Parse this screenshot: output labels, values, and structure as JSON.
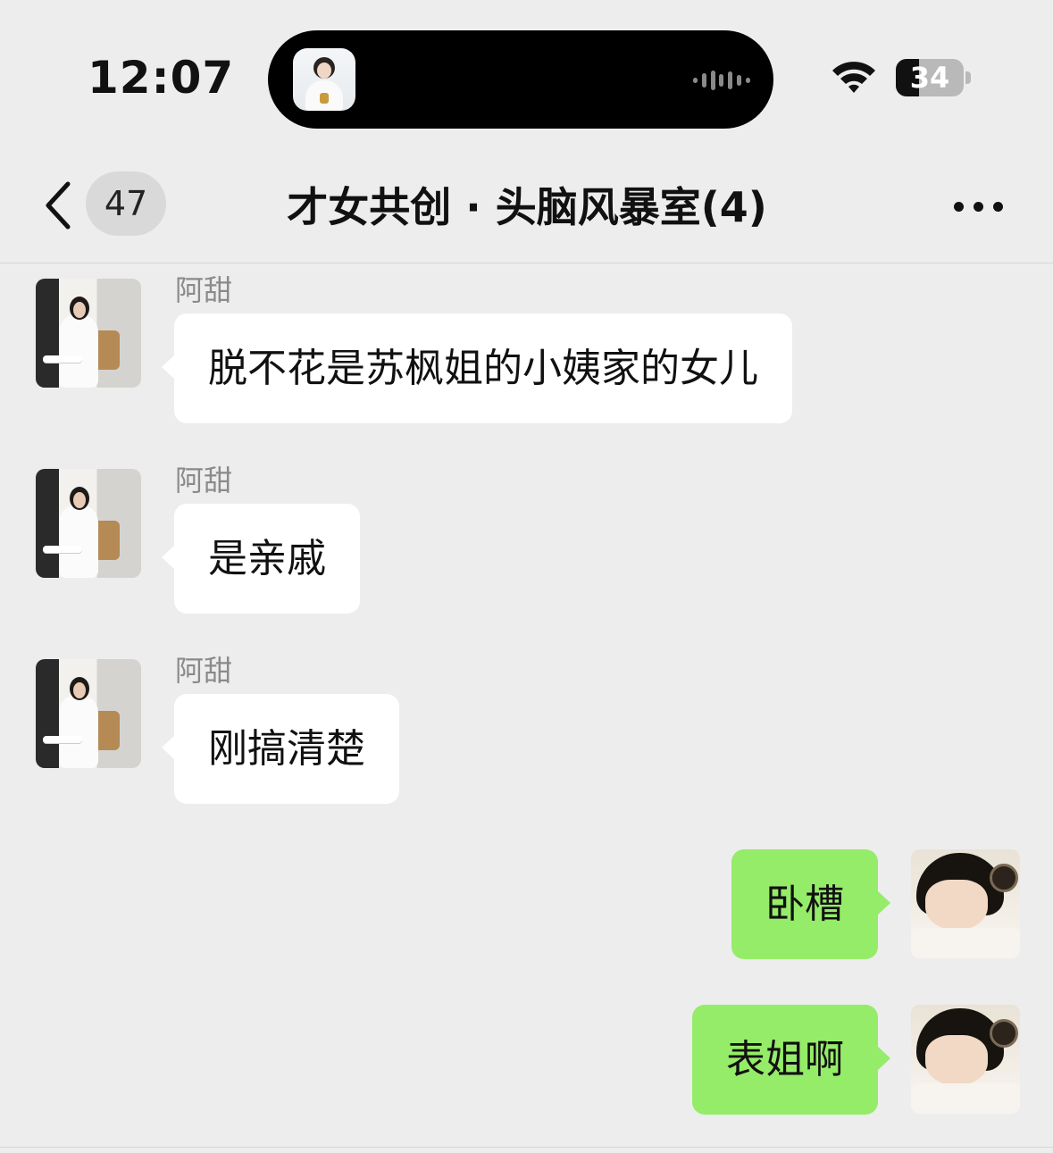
{
  "status_bar": {
    "time": "12:07",
    "battery_level": "34",
    "battery_fraction": 0.34,
    "wifi_icon": "wifi-icon",
    "island_icon": "app-avatar-icon"
  },
  "nav": {
    "back_icon": "chevron-left-icon",
    "unread_count": "47",
    "title": "才女共创 · 头脑风暴室(4)",
    "more_icon": "ellipsis-icon"
  },
  "messages": [
    {
      "direction": "received",
      "sender": "阿甜",
      "text": "脱不花是苏枫姐的小姨家的女儿"
    },
    {
      "direction": "received",
      "sender": "阿甜",
      "text": "是亲戚"
    },
    {
      "direction": "received",
      "sender": "阿甜",
      "text": "刚搞清楚"
    },
    {
      "direction": "sent",
      "text": "卧槽"
    },
    {
      "direction": "sent",
      "text": "表姐啊"
    }
  ],
  "colors": {
    "background": "#ededed",
    "received_bubble": "#ffffff",
    "sent_bubble": "#95ec69",
    "sender_name": "#8a8a8a",
    "badge": "#d9d9d9"
  }
}
